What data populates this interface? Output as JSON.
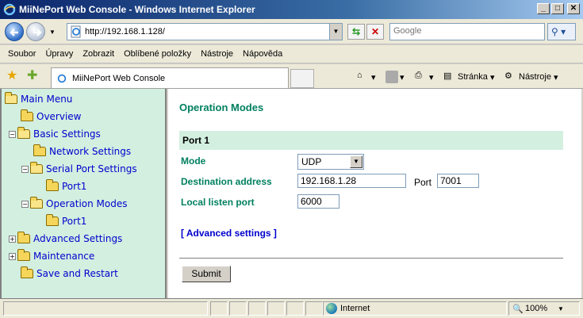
{
  "window": {
    "title": "MiiNePort Web Console - Windows Internet Explorer",
    "controls": [
      "_",
      "□",
      "✕"
    ]
  },
  "address": {
    "url": "http://192.168.1.128/",
    "search_placeholder": "Google"
  },
  "menu": [
    "Soubor",
    "Úpravy",
    "Zobrazit",
    "Oblíbené položky",
    "Nástroje",
    "Nápověda"
  ],
  "tab": {
    "label": "MiiNePort Web Console"
  },
  "commands": {
    "page": "Stránka",
    "tools": "Nástroje"
  },
  "sidebar": {
    "items": [
      {
        "label": "Main Menu",
        "expander": ""
      },
      {
        "label": "Overview",
        "expander": ""
      },
      {
        "label": "Basic Settings",
        "expander": "−"
      },
      {
        "label": "Network Settings",
        "expander": ""
      },
      {
        "label": "Serial Port Settings",
        "expander": "−"
      },
      {
        "label": "Port1",
        "expander": ""
      },
      {
        "label": "Operation Modes",
        "expander": "−"
      },
      {
        "label": "Port1",
        "expander": ""
      },
      {
        "label": "Advanced Settings",
        "expander": "+"
      },
      {
        "label": "Maintenance",
        "expander": "+"
      },
      {
        "label": "Save and Restart",
        "expander": ""
      }
    ]
  },
  "main": {
    "title": "Operation Modes",
    "section": "Port 1",
    "mode_label": "Mode",
    "mode_value": "UDP",
    "dest_label": "Destination address",
    "dest_value": "192.168.1.28",
    "port_label": "Port",
    "port_value": "7001",
    "listen_label": "Local listen port",
    "listen_value": "6000",
    "advanced_link": "[ Advanced settings ]",
    "submit": "Submit"
  },
  "status": {
    "zone": "Internet",
    "zoom": "100%"
  }
}
